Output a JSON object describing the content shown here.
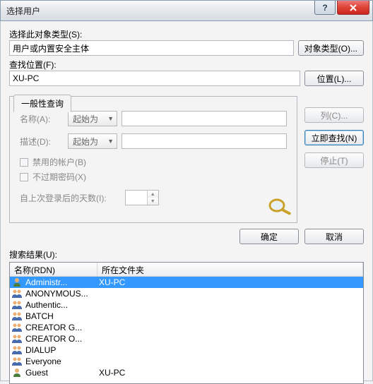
{
  "window": {
    "title": "选择用户"
  },
  "objectType": {
    "label": "选择此对象类型(S):",
    "value": "用户或内置安全主体",
    "button": "对象类型(O)..."
  },
  "location": {
    "label": "查找位置(F):",
    "value": "XU-PC",
    "button": "位置(L)..."
  },
  "tab": {
    "label": "一般性查询"
  },
  "query": {
    "nameLabel": "名称(A):",
    "nameOp": "起始为",
    "descLabel": "描述(D):",
    "descOp": "起始为",
    "disabledAcct": "禁用的帐户(B)",
    "nonExpPwd": "不过期密码(X)",
    "daysLabel": "自上次登录后的天数(I):"
  },
  "sideButtons": {
    "columns": "列(C)...",
    "findNow": "立即查找(N)",
    "stop": "停止(T)"
  },
  "footer": {
    "ok": "确定",
    "cancel": "取消"
  },
  "results": {
    "label": "搜索结果(U):",
    "colName": "名称(RDN)",
    "colFolder": "所在文件夹",
    "rows": [
      {
        "name": "Administr...",
        "folder": "XU-PC",
        "icon": "single",
        "selected": true
      },
      {
        "name": "ANONYMOUS...",
        "folder": "",
        "icon": "multi"
      },
      {
        "name": "Authentic...",
        "folder": "",
        "icon": "multi"
      },
      {
        "name": "BATCH",
        "folder": "",
        "icon": "multi"
      },
      {
        "name": "CREATOR G...",
        "folder": "",
        "icon": "multi"
      },
      {
        "name": "CREATOR O...",
        "folder": "",
        "icon": "multi"
      },
      {
        "name": "DIALUP",
        "folder": "",
        "icon": "multi"
      },
      {
        "name": "Everyone",
        "folder": "",
        "icon": "multi"
      },
      {
        "name": "Guest",
        "folder": "XU-PC",
        "icon": "single"
      }
    ]
  }
}
